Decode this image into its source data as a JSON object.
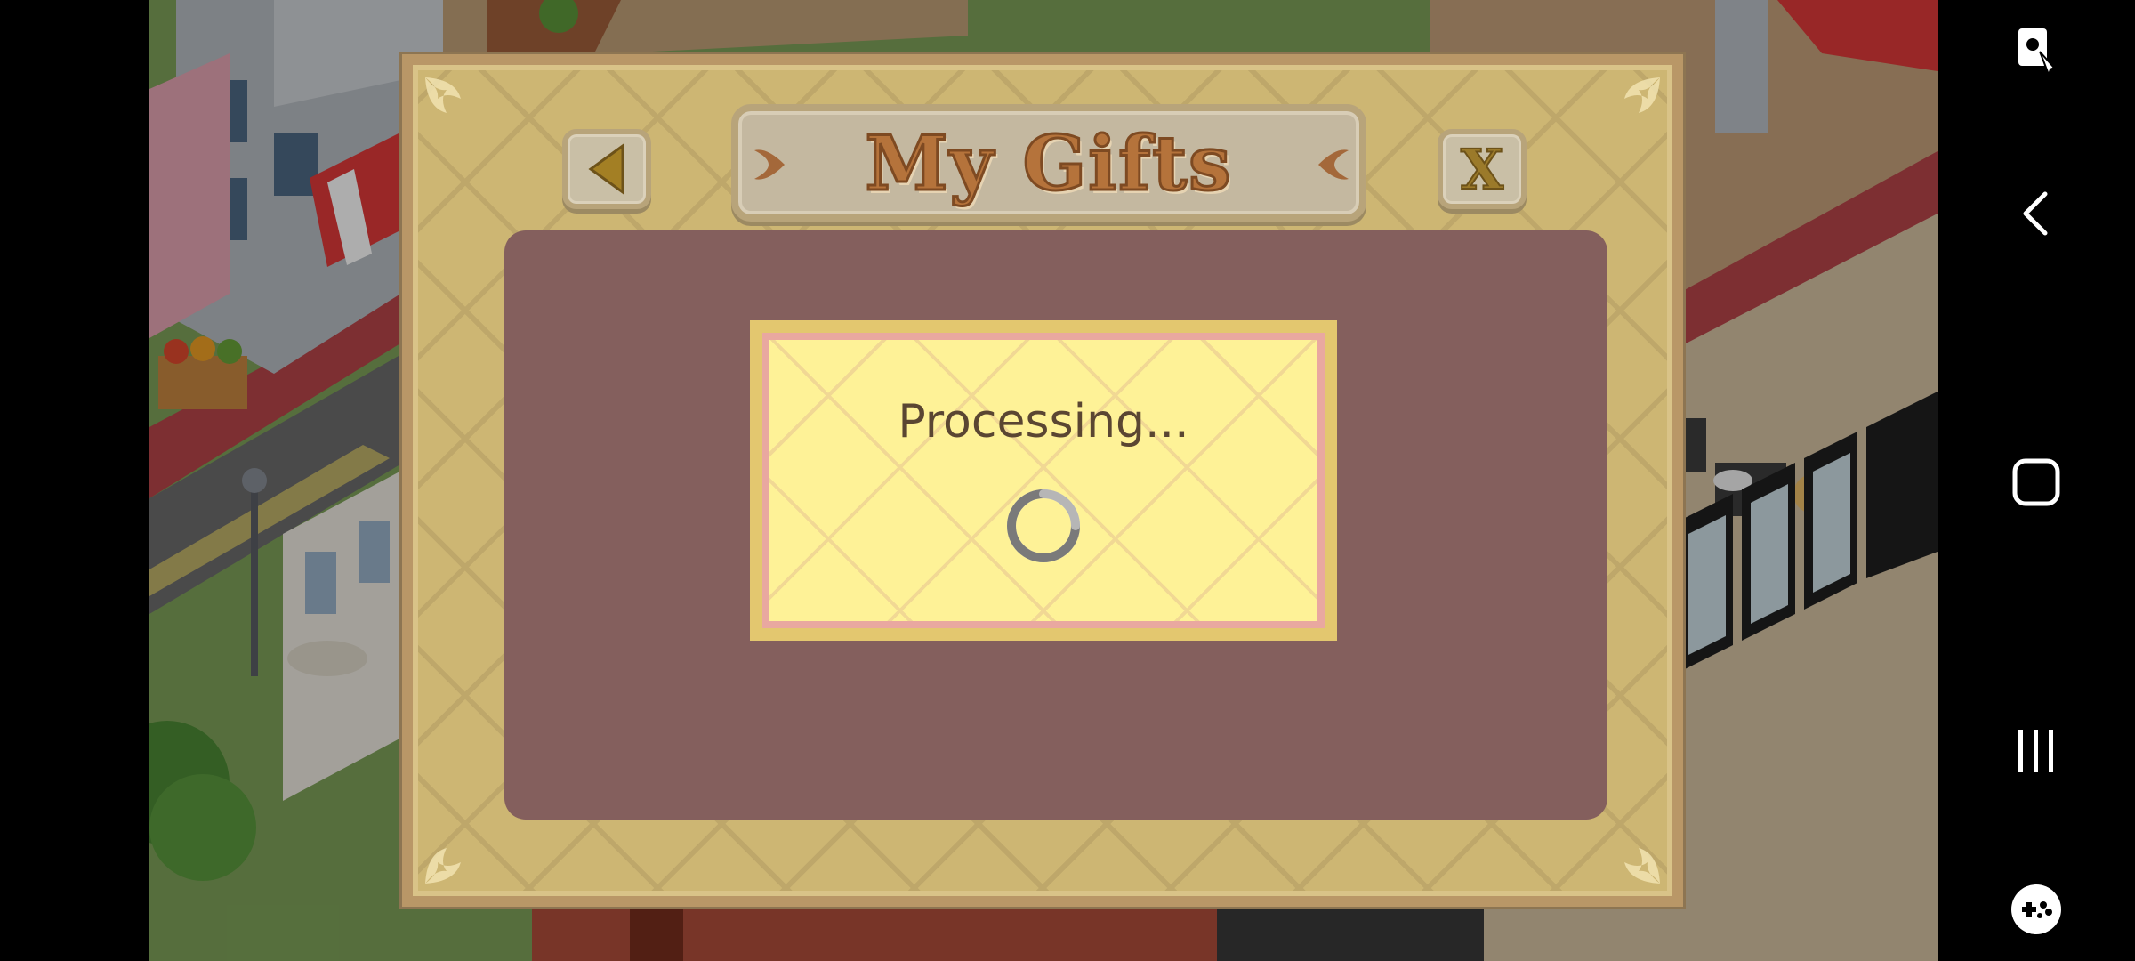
{
  "dialog": {
    "title": "My Gifts",
    "close_label": "X"
  },
  "processing": {
    "message": "Processing..."
  },
  "icons": {
    "back": "back-arrow-icon",
    "spinner": "loading-spinner-icon",
    "screen_lock": "screen-lock-icon",
    "nav_back": "chevron-left-icon",
    "home": "home-square-icon",
    "recents": "recent-apps-icon",
    "game_tools": "game-controller-icon"
  },
  "colors": {
    "dialog_gold": "#cdb673",
    "content_panel": "#845f5d",
    "popup_yellow": "#fef297",
    "title_text": "#b5733b"
  }
}
